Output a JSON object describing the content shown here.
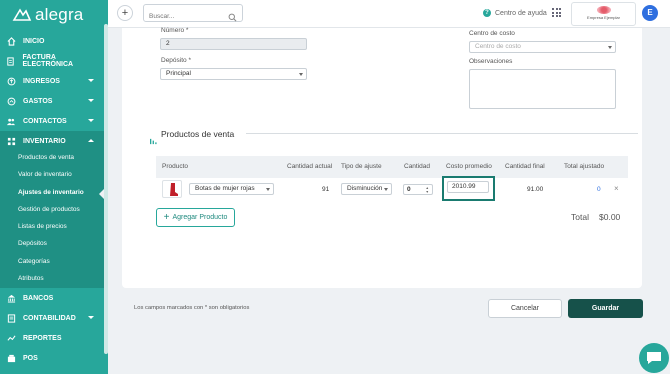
{
  "app": {
    "logo_text": "alegra"
  },
  "topbar": {
    "add_label": "+",
    "search_placeholder": "Buscar...",
    "help_label": "Centro de ayuda",
    "company_name": "Empresa Ejemplar",
    "avatar_initial": "E"
  },
  "sidebar": {
    "items": [
      {
        "label": "INICIO",
        "icon": "home-icon"
      },
      {
        "label": "FACTURA ELECTRÓNICA",
        "icon": "invoice-icon"
      },
      {
        "label": "INGRESOS",
        "icon": "income-icon"
      },
      {
        "label": "GASTOS",
        "icon": "expenses-icon"
      },
      {
        "label": "CONTACTOS",
        "icon": "contacts-icon"
      },
      {
        "label": "INVENTARIO",
        "icon": "inventory-icon"
      },
      {
        "label": "BANCOS",
        "icon": "bank-icon"
      },
      {
        "label": "CONTABILIDAD",
        "icon": "accounting-icon"
      },
      {
        "label": "REPORTES",
        "icon": "reports-icon"
      },
      {
        "label": "POS",
        "icon": "pos-icon"
      }
    ],
    "inventory_sub": [
      "Productos de venta",
      "Valor de inventario",
      "Ajustes de inventario",
      "Gestión de productos",
      "Listas de precios",
      "Depósitos",
      "Categorías",
      "Atributos"
    ]
  },
  "form": {
    "numero_label": "Número *",
    "numero_value": "2",
    "deposito_label": "Depósito *",
    "deposito_value": "Principal",
    "centro_costo_label": "Centro de costo",
    "centro_costo_placeholder": "Centro de costo",
    "observaciones_label": "Observaciones"
  },
  "products": {
    "section_title": "Productos de venta",
    "headers": [
      "Producto",
      "Cantidad actual",
      "Tipo de ajuste",
      "Cantidad",
      "Costo promedio",
      "Cantidad final",
      "Total ajustado"
    ],
    "row": {
      "product": "Botas de mujer rojas",
      "current_qty": "91",
      "adjust_type": "Disminución",
      "qty": "0",
      "avg_cost": "2010.99",
      "final_qty": "91.00",
      "total": "0",
      "remove": "×"
    },
    "add_label": "Agregar Producto",
    "total_label": "Total",
    "total_value": "$0.00"
  },
  "footer": {
    "required_note": "Los campos marcados con * son obligatorios",
    "cancel_label": "Cancelar",
    "save_label": "Guardar"
  },
  "colors": {
    "brand": "#27a79b",
    "brand_dark": "#1f9084",
    "save": "#16514a",
    "highlight": "#1a7b70"
  }
}
